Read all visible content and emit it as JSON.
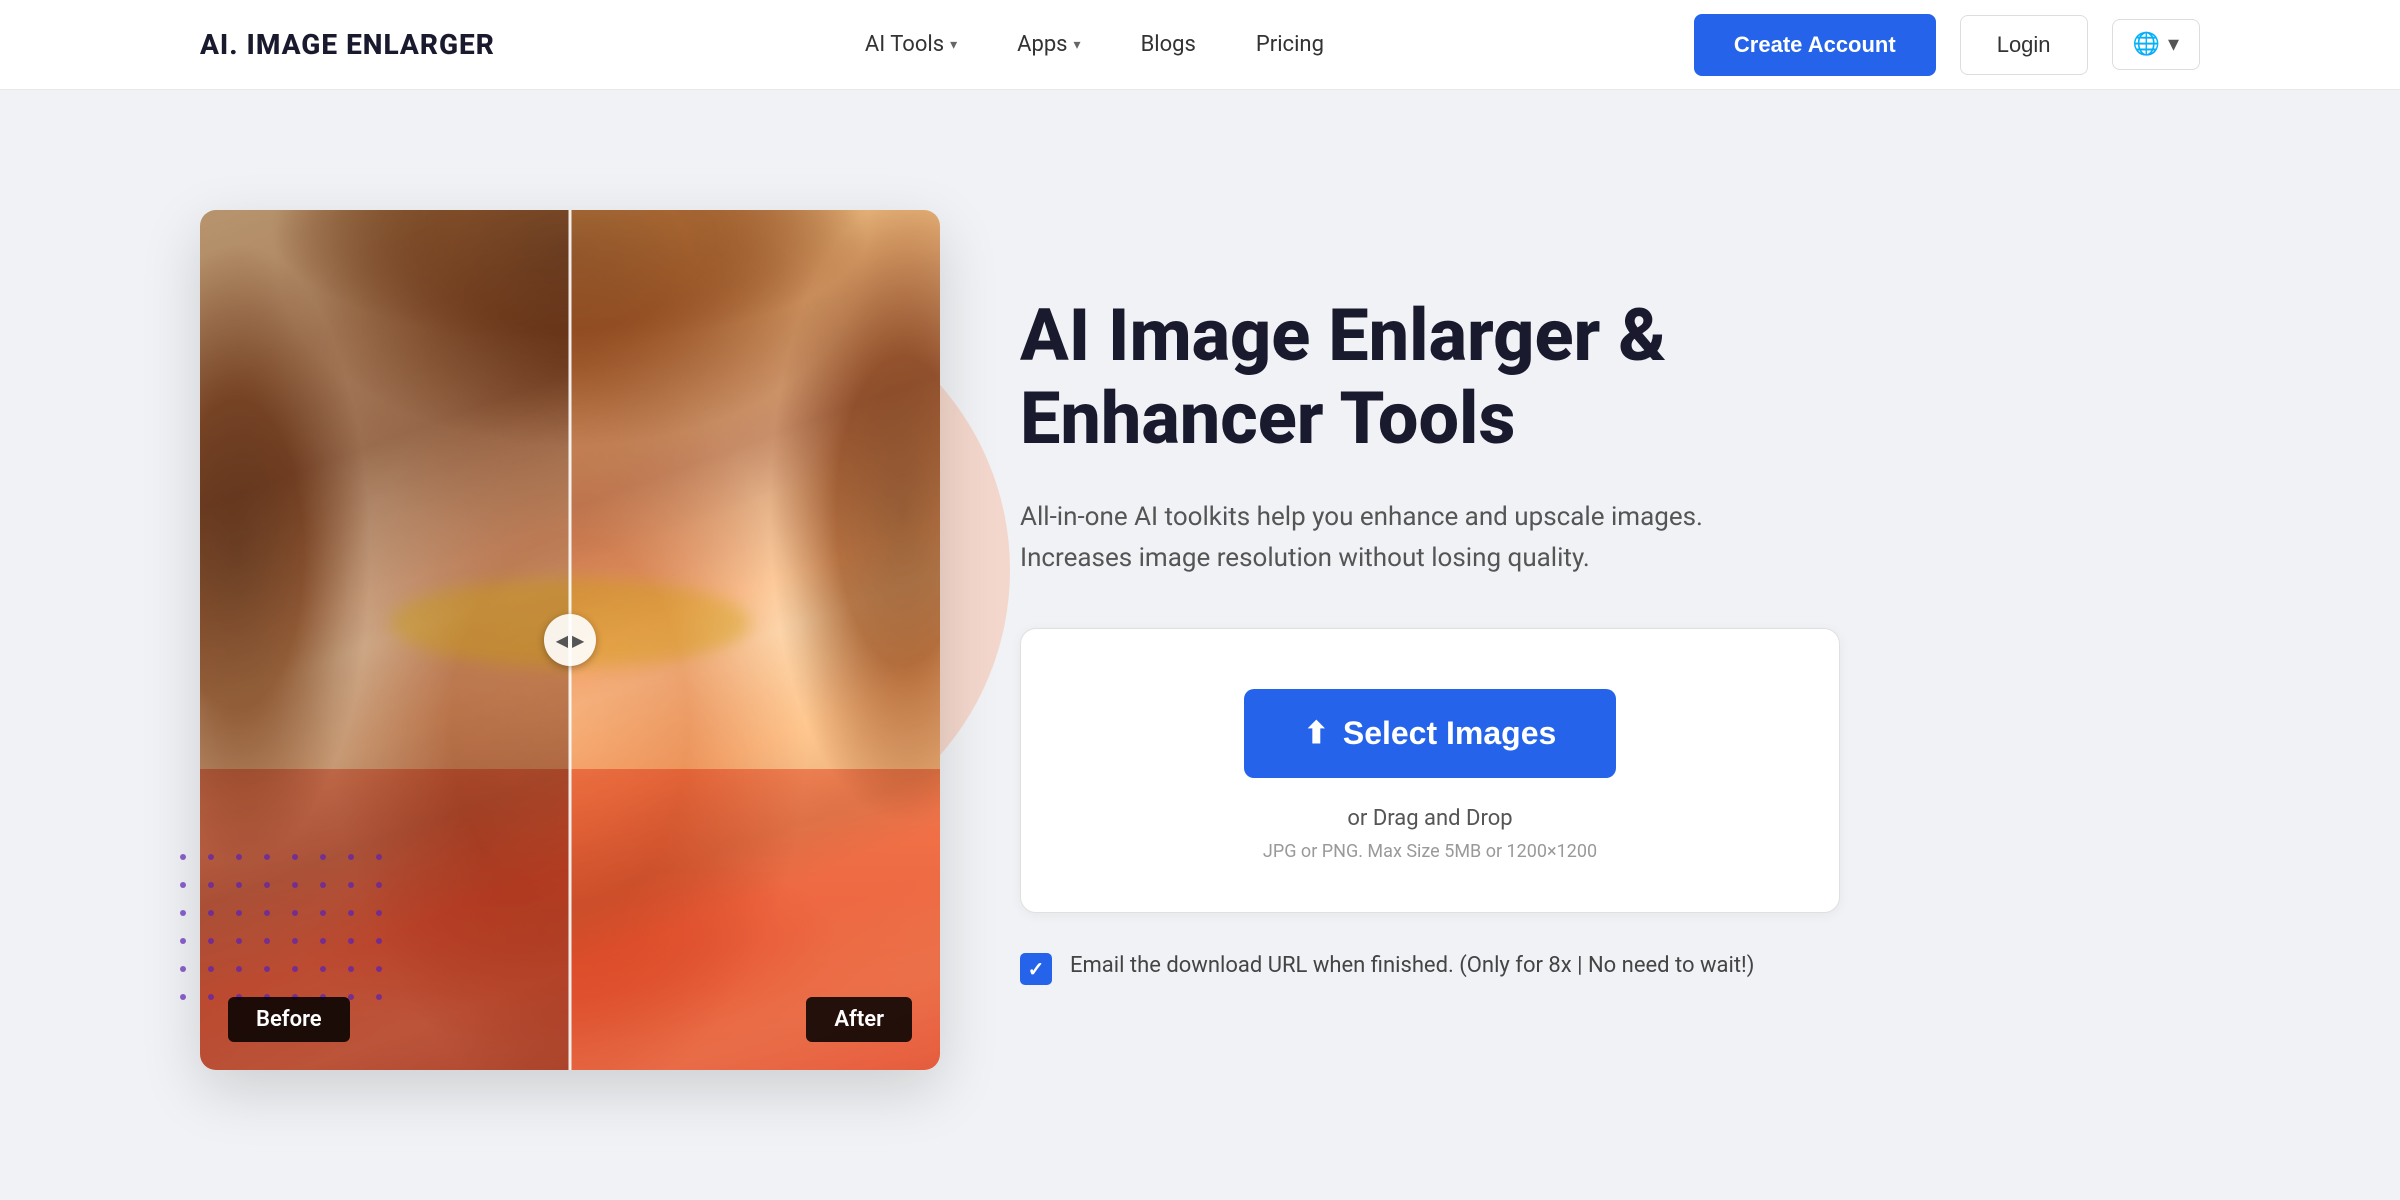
{
  "navbar": {
    "logo": "AI. IMAGE ENLARGER",
    "nav_items": [
      {
        "label": "AI Tools",
        "has_dropdown": true
      },
      {
        "label": "Apps",
        "has_dropdown": true
      },
      {
        "label": "Blogs",
        "has_dropdown": false
      },
      {
        "label": "Pricing",
        "has_dropdown": false
      }
    ],
    "create_account_label": "Create Account",
    "login_label": "Login",
    "lang_label": "🌐"
  },
  "hero": {
    "title": "AI Image Enlarger & Enhancer Tools",
    "subtitle": "All-in-one AI toolkits help you enhance and upscale images. Increases image resolution without losing quality.",
    "before_label": "Before",
    "after_label": "After",
    "select_images_label": "Select Images",
    "drag_drop_label": "or Drag and Drop",
    "file_info_label": "JPG or PNG. Max Size 5MB or 1200×1200",
    "email_text": "Email the download URL when finished. (Only for 8x | No need to wait!)"
  },
  "upload_icon": "⬆"
}
